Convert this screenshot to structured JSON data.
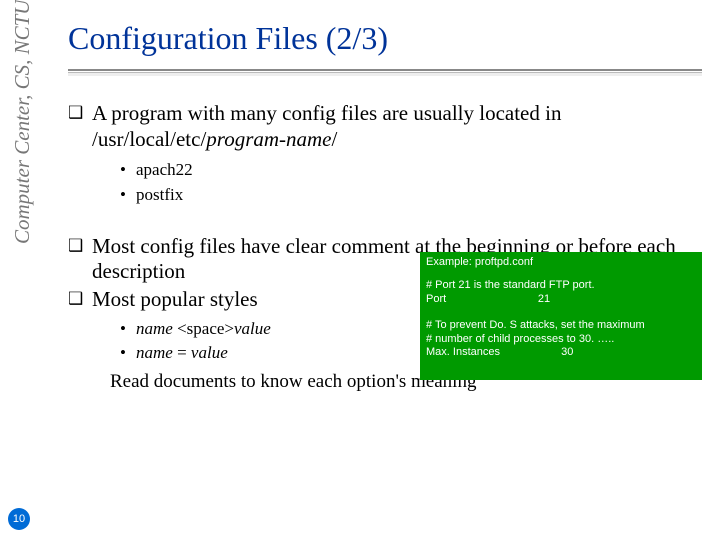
{
  "sidebar": {
    "label": "Computer Center, CS, NCTU"
  },
  "page_number": "10",
  "title": "Configuration Files (2/3)",
  "bullets": {
    "b1_prefix": "A program with many config files are usually located in ",
    "b1_path_prefix": "/usr/local/etc/",
    "b1_path_italic": "program-name",
    "b1_path_suffix": "/",
    "sub_a": "apach22",
    "sub_b": "postfix",
    "b2": "Most config files have clear comment at the beginning or before each description",
    "b3": "Most popular styles",
    "style_a_name": "name ",
    "style_a_mid": "<space>",
    "style_a_val": "value",
    "style_b_name": "name ",
    "style_b_eq": "= ",
    "style_b_val": "value",
    "read_docs": "Read documents to know each option's meaning"
  },
  "greenbox": {
    "title": "Example: proftpd.conf",
    "l1": "# Port 21 is the standard FTP port.",
    "l2": "Port                              21",
    "l3": "# To prevent Do. S attacks, set the maximum",
    "l4": "# number of child processes to 30. …..",
    "l5": "Max. Instances                    30"
  }
}
